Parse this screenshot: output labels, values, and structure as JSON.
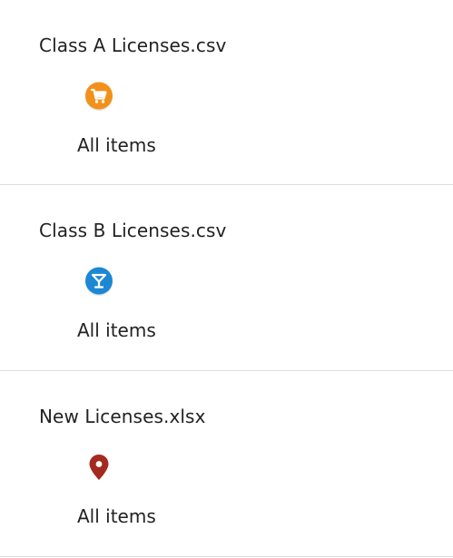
{
  "layers": [
    {
      "title": "Class A Licenses.csv",
      "icon": "shopping-cart-icon",
      "icon_color": "#f39019",
      "subtitle": "All items"
    },
    {
      "title": "Class B Licenses.csv",
      "icon": "cocktail-glass-icon",
      "icon_color": "#1c88d4",
      "subtitle": "All items"
    },
    {
      "title": "New Licenses.xlsx",
      "icon": "map-pin-icon",
      "icon_color": "#a32a1e",
      "subtitle": "All items"
    }
  ]
}
